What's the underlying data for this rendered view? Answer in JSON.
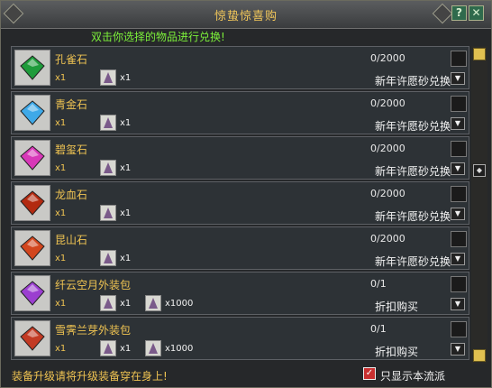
{
  "window": {
    "title": "惊蛰惊喜购",
    "help": "?",
    "close": "✕"
  },
  "hint": "双击你选择的物品进行兑换!",
  "items": [
    {
      "name": "孔雀石",
      "qty": "x1",
      "costs": [
        "x1"
      ],
      "count": "0/2000",
      "action": "新年许愿砂兑换",
      "icon": "peacock-stone-icon",
      "color": "#1e9b3a"
    },
    {
      "name": "青金石",
      "qty": "x1",
      "costs": [
        "x1"
      ],
      "count": "0/2000",
      "action": "新年许愿砂兑换",
      "icon": "lapis-stone-icon",
      "color": "#3fa9e8"
    },
    {
      "name": "碧玺石",
      "qty": "x1",
      "costs": [
        "x1"
      ],
      "count": "0/2000",
      "action": "新年许愿砂兑换",
      "icon": "tourmaline-stone-icon",
      "color": "#d838b8"
    },
    {
      "name": "龙血石",
      "qty": "x1",
      "costs": [
        "x1"
      ],
      "count": "0/2000",
      "action": "新年许愿砂兑换",
      "icon": "dragonblood-stone-icon",
      "color": "#b22a10"
    },
    {
      "name": "昆山石",
      "qty": "x1",
      "costs": [
        "x1"
      ],
      "count": "0/2000",
      "action": "新年许愿砂兑换",
      "icon": "kunshan-stone-icon",
      "color": "#d2461e"
    },
    {
      "name": "纤云空月外装包",
      "qty": "x1",
      "costs": [
        "x1",
        "x1000"
      ],
      "count": "0/1",
      "action": "折扣购买",
      "icon": "purple-bag-icon",
      "color": "#9b3ed0"
    },
    {
      "name": "雪霁兰芽外装包",
      "qty": "x1",
      "costs": [
        "x1",
        "x1000"
      ],
      "count": "0/1",
      "action": "折扣购买",
      "icon": "red-bag-icon",
      "color": "#c23a24"
    }
  ],
  "footer": {
    "note": "装备升级请将升级装备穿在身上!",
    "filter_label": "只显示本流派",
    "filter_checked": "✓"
  },
  "colors": {
    "gold": "#f0c452",
    "hint": "#7cf03a",
    "row_bg": "#2d3236"
  }
}
